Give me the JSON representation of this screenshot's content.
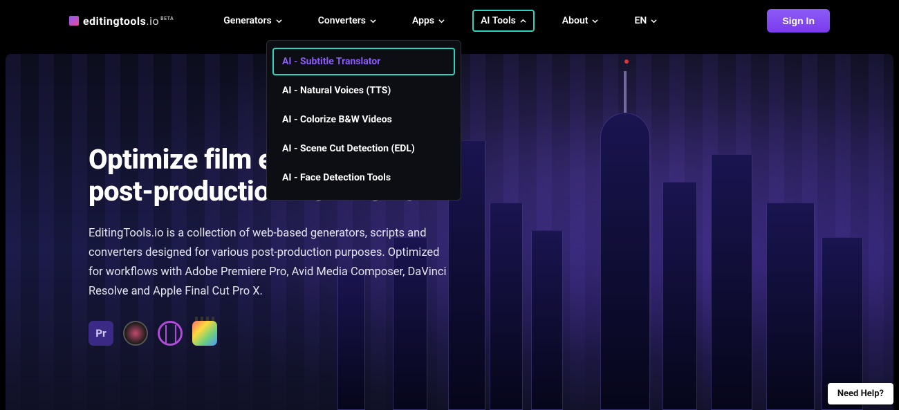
{
  "brand": {
    "name": "editingtools",
    "suffix": ".io",
    "badge": "BETA"
  },
  "nav": {
    "generators": "Generators",
    "converters": "Converters",
    "apps": "Apps",
    "aitools": "AI Tools",
    "about": "About",
    "lang": "EN"
  },
  "signin": "Sign In",
  "dropdown": {
    "items": [
      "AI - Subtitle Translator",
      "AI - Natural Voices (TTS)",
      "AI - Colorize B&W Videos",
      "AI - Scene Cut Detection (EDL)",
      "AI - Face Detection Tools"
    ]
  },
  "hero": {
    "headline_l1": "Optimize film editing and",
    "headline_l2": "post-production workflows",
    "sub": "EditingTools.io is a collection of web-based generators, scripts and converters designed for various post-production purposes. Optimized for workflows with Adobe Premiere Pro, Avid Media Composer, DaVinci Resolve and Apple Final Cut Pro X."
  },
  "apps": {
    "pr": "Pr"
  },
  "help": "Need Help?"
}
